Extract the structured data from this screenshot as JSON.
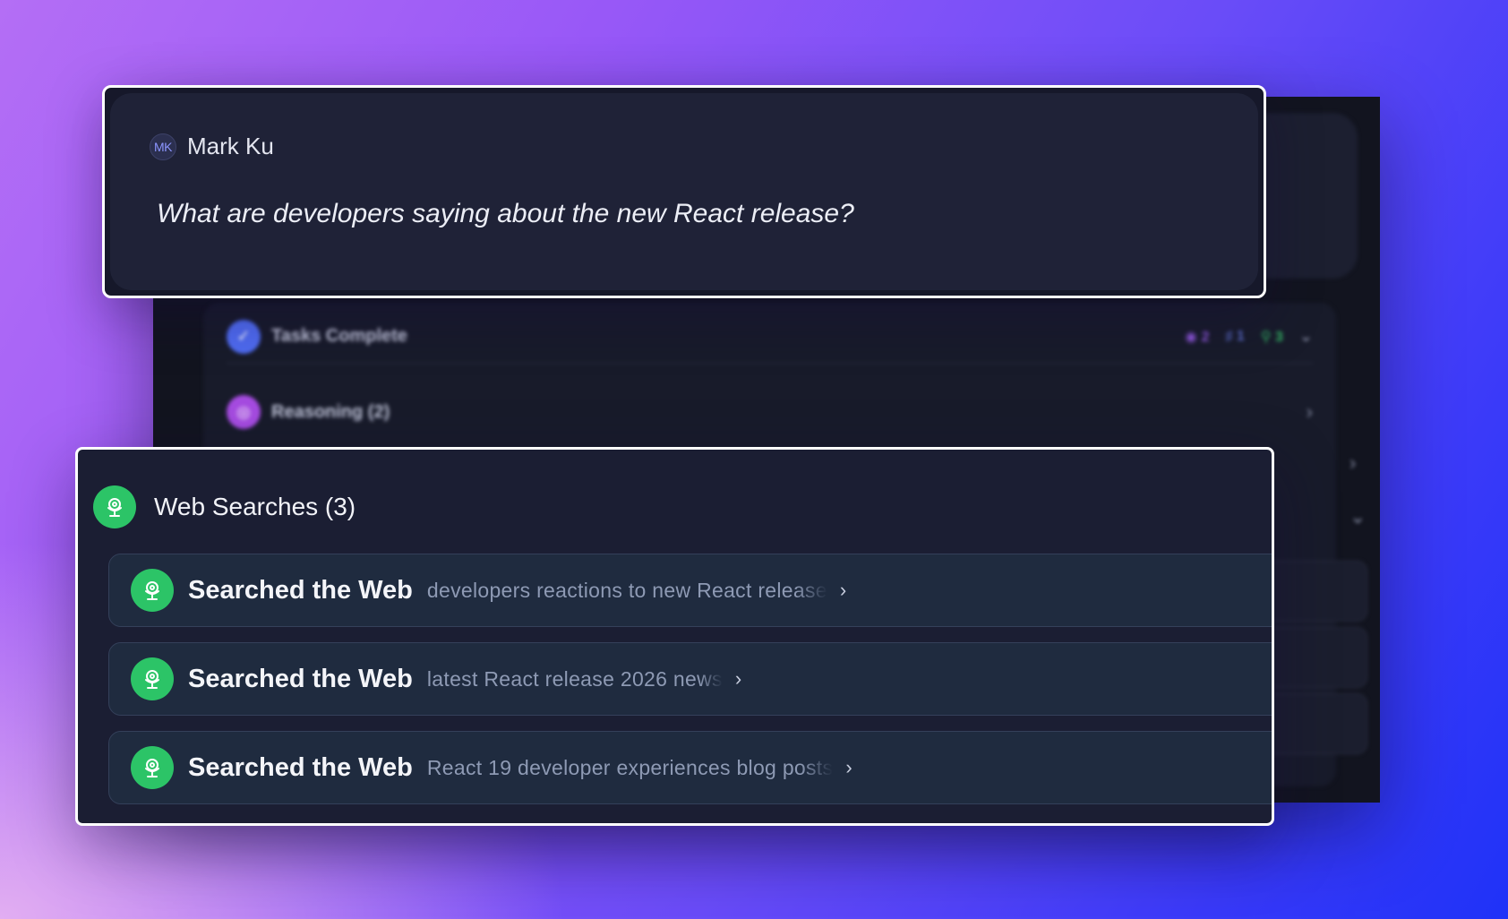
{
  "background_window": {
    "tasks_row": {
      "label": "Tasks Complete",
      "stats": [
        "2",
        "1",
        "3"
      ]
    },
    "reasoning_row": {
      "label": "Reasoning (2)"
    }
  },
  "message": {
    "avatar_initials": "MK",
    "user_name": "Mark Ku",
    "question": "What are developers saying about the new React release?"
  },
  "web_searches": {
    "title": "Web Searches (3)",
    "items": [
      {
        "label": "Searched the Web",
        "query": "developers reactions to new React release"
      },
      {
        "label": "Searched the Web",
        "query": "latest React release 2026 news"
      },
      {
        "label": "Searched the Web",
        "query": "React 19 developer experiences blog posts"
      }
    ]
  },
  "colors": {
    "accent_green": "#2cc467",
    "card_bg": "#1f2237",
    "item_bg": "#1f2b3f"
  }
}
